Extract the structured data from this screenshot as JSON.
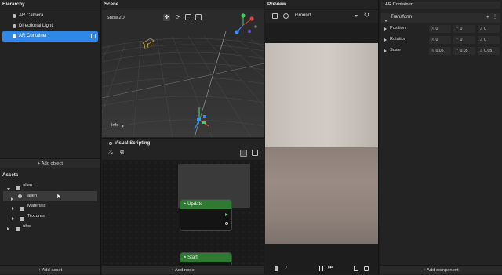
{
  "hierarchy": {
    "title": "Hierarchy",
    "items": [
      {
        "label": "AR Camera"
      },
      {
        "label": "Directional Light"
      },
      {
        "label": "AR Container"
      }
    ],
    "add_label": "+ Add object"
  },
  "assets": {
    "title": "Assets",
    "root": "alien",
    "child": "alien",
    "folders": [
      "Materials",
      "Textures"
    ],
    "root2": "ufos",
    "add_label": "+ Add asset"
  },
  "scene": {
    "title": "Scene",
    "mode_label": "Show 2D",
    "info_label": "Info"
  },
  "visual_scripting": {
    "title": "Visual Scripting",
    "nodes": [
      {
        "label": "Update"
      },
      {
        "label": "Start"
      }
    ],
    "add_label": "+ Add node"
  },
  "preview": {
    "title": "Preview",
    "dropdown_value": "Ground"
  },
  "inspector": {
    "object_name": "AR Container",
    "section": "Transform",
    "rows": [
      {
        "label": "Position",
        "x": "0",
        "y": "0",
        "z": "0"
      },
      {
        "label": "Rotation",
        "x": "0",
        "y": "0",
        "z": "0"
      },
      {
        "label": "Scale",
        "x": "0.05",
        "y": "0.05",
        "z": "0.05"
      }
    ],
    "add_label": "+ Add component"
  },
  "colors": {
    "accent": "#2f88e8",
    "node_header": "#2f7a32",
    "panel_bg": "#232323"
  }
}
